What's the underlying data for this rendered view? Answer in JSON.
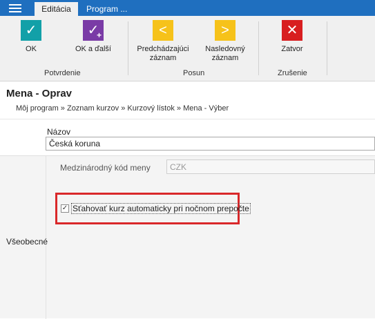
{
  "topbar": {
    "tabs": [
      {
        "label": "Editácia",
        "active": true
      },
      {
        "label": "Program ...",
        "active": false
      }
    ]
  },
  "ribbon": {
    "buttons": [
      {
        "label": "OK",
        "icon": "check-icon",
        "color": "#12a0a8"
      },
      {
        "label": "OK a ďalší",
        "icon": "check-plus-icon",
        "color": "#7a3ba6"
      },
      {
        "label_line1": "Predchádzajúci",
        "label_line2": "záznam",
        "icon": "chevron-left-icon",
        "color": "#f6c21a"
      },
      {
        "label_line1": "Nasledovný",
        "label_line2": "záznam",
        "icon": "chevron-right-icon",
        "color": "#f6c21a"
      },
      {
        "label": "Zatvor",
        "icon": "close-icon",
        "color": "#d81e20"
      }
    ],
    "groups": [
      "Potvrdenie",
      "Posun",
      "Zrušenie"
    ]
  },
  "page": {
    "title": "Mena - Oprav",
    "breadcrumb": "Môj program » Zoznam kurzov » Kurzový lístok » Mena - Výber"
  },
  "form": {
    "name_label": "Názov",
    "name_value": "Česká koruna",
    "code_label": "Medzinárodný kód meny",
    "code_value": "CZK",
    "auto_download_label": "Sťahovať kurz automaticky pri nočnom prepočte",
    "auto_download_checked": true,
    "section_label": "Všeobecné"
  }
}
